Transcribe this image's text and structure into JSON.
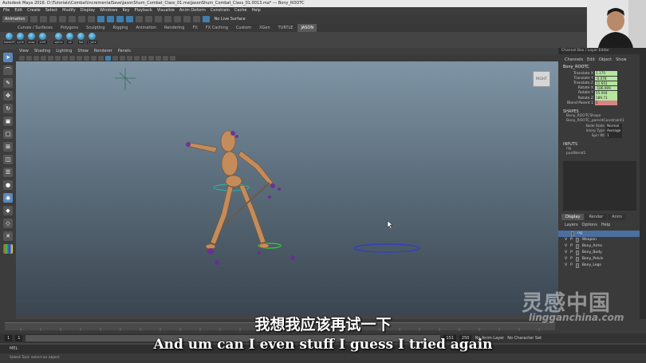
{
  "window": {
    "title": "Autodesk Maya 2016: D:\\Tutorials\\Combat\\incrementalSave\\JasonShum_Combat_Class_01.ma\\JasonShum_Combat_Class_01.0013.ma*    ---    Bony_ROOTC"
  },
  "menubar": [
    "File",
    "Edit",
    "Create",
    "Select",
    "Modify",
    "Display",
    "Windows",
    "Key",
    "Playback",
    "Visualize",
    "Anim Deform",
    "Constrain",
    "Cache",
    "Help"
  ],
  "status_line": {
    "mode": "Animation",
    "live_surface": "No Live Surface"
  },
  "shelf": {
    "tabs": [
      "Curves / Surfaces",
      "Polygons",
      "Sculpting",
      "Rigging",
      "Animation",
      "Rendering",
      "FX",
      "FX Caching",
      "Custom",
      "XGen",
      "TURTLE",
      "JASON"
    ],
    "active_tab": "JASON",
    "buttons": [
      "tweenM",
      "cycle",
      "snap",
      "ctrlit",
      "spline",
      "all",
      "flat",
      "t_wire"
    ]
  },
  "panel_menu": [
    "View",
    "Shading",
    "Lighting",
    "Show",
    "Renderer",
    "Panels"
  ],
  "viewport": {
    "viewcube_label": "RIGHT"
  },
  "channel_box": {
    "header": "Channel Box / Layer Editor",
    "menu": [
      "Channels",
      "Edit",
      "Object",
      "Show"
    ],
    "object": "Bony_ROOTC",
    "attributes": [
      {
        "name": "Translate X",
        "value": "1.175"
      },
      {
        "name": "Translate Y",
        "value": "-0.078"
      },
      {
        "name": "Translate Z",
        "value": "11.601"
      },
      {
        "name": "Rotate X",
        "value": "-186.909"
      },
      {
        "name": "Rotate Y",
        "value": "55.004"
      },
      {
        "name": "Rotate Z",
        "value": "189.71"
      },
      {
        "name": "Blend Parent 1",
        "value": "1"
      }
    ],
    "shapes_title": "SHAPES",
    "shapes": [
      "Bony_ROOTCShape",
      "Bony_ROOTC_parentConstraint1"
    ],
    "shape_attrs": [
      {
        "name": "Node State",
        "value": "Normal"
      },
      {
        "name": "Interp Type",
        "value": "Average"
      },
      {
        "name": "Spin Wt",
        "value": "1"
      }
    ],
    "inputs_title": "INPUTS",
    "inputs": [
      "rig",
      "pairBlend1"
    ]
  },
  "layer_editor": {
    "tabs": [
      "Display",
      "Render",
      "Anim"
    ],
    "menu": [
      "Layers",
      "Options",
      "Help"
    ],
    "layers": [
      {
        "v": "",
        "p": "",
        "name": "rig"
      },
      {
        "v": "V",
        "p": "P",
        "name": "Weapon"
      },
      {
        "v": "V",
        "p": "P",
        "name": "Bony_Arms"
      },
      {
        "v": "V",
        "p": "P",
        "name": "Bony_Body"
      },
      {
        "v": "V",
        "p": "P",
        "name": "Bony_Pelvis"
      },
      {
        "v": "V",
        "p": "P",
        "name": "Bony_Legs"
      }
    ]
  },
  "range": {
    "start": "1",
    "start2": "1",
    "end2": "151",
    "end": "250",
    "anim_layer": "No Anim Layer",
    "char_set": "No Character Set"
  },
  "mel_label": "MEL",
  "help_line": "Select Tool: select an object",
  "subtitles": {
    "cn": "我想我应该再试一下",
    "en": "And um can I even stuff I guess I tried again"
  },
  "watermark": {
    "cn": "灵感中国",
    "en": "lingganchina.com"
  },
  "colors": {
    "attr_green": "#b6e6a2",
    "attr_red": "#d98585",
    "layer_selected": "#4a6fa0",
    "viewport_top": "#7f95a5",
    "viewport_bottom": "#3a4550"
  }
}
